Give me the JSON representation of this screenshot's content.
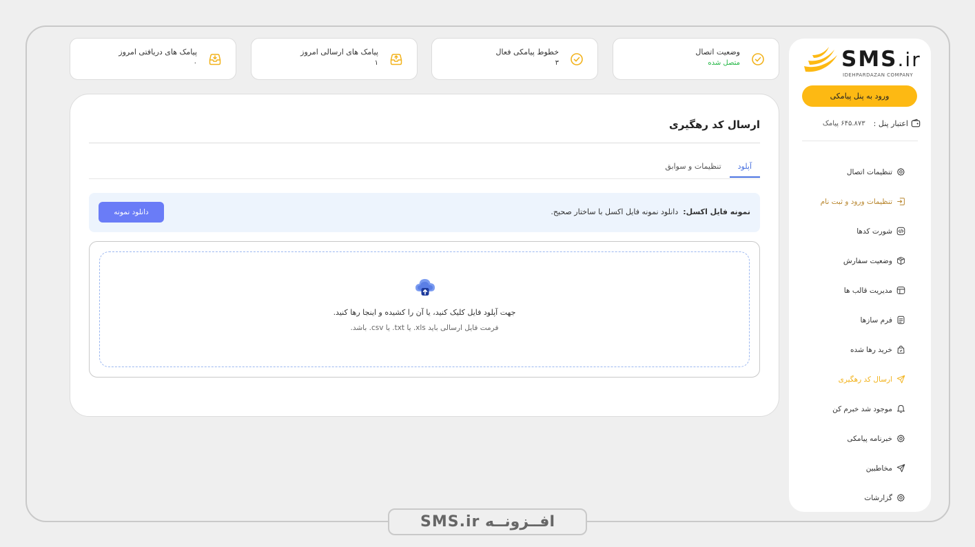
{
  "brand": {
    "name": "SMS",
    "tld": "ir",
    "subtitle": "IDEHPARDAZAN COMPANY"
  },
  "sidebar": {
    "panel_button": "ورود به پنل پیامکی",
    "credit_label": "اعتبار پنل :",
    "credit_value": "۶۴۵.۸۷۳ پیامک",
    "items": [
      {
        "label": "تنظیمات اتصال",
        "icon": "gear-icon",
        "state": "normal"
      },
      {
        "label": "تنظیمات ورود و ثبت نام",
        "icon": "login-icon",
        "state": "gold"
      },
      {
        "label": "شورت کدها",
        "icon": "code-icon",
        "state": "normal"
      },
      {
        "label": "وضعیت سفارش",
        "icon": "package-icon",
        "state": "normal"
      },
      {
        "label": "مدیریت قالب ها",
        "icon": "template-icon",
        "state": "normal"
      },
      {
        "label": "فرم سازها",
        "icon": "form-icon",
        "state": "normal"
      },
      {
        "label": "خرید رها شده",
        "icon": "bag-icon",
        "state": "normal"
      },
      {
        "label": "ارسال کد رهگیری",
        "icon": "send-icon",
        "state": "active"
      },
      {
        "label": "موجود شد خبرم کن",
        "icon": "bell-icon",
        "state": "normal"
      },
      {
        "label": "خبرنامه پیامکی",
        "icon": "gear-icon",
        "state": "normal"
      },
      {
        "label": "مخاطبین",
        "icon": "send-icon",
        "state": "normal"
      },
      {
        "label": "گزارشات",
        "icon": "gear-icon",
        "state": "normal"
      }
    ]
  },
  "stats": {
    "connection": {
      "label": "وضعیت اتصال",
      "value": "متصل شده"
    },
    "lines": {
      "label": "خطوط پیامکی فعال",
      "value": "۳"
    },
    "sent": {
      "label": "پیامک های ارسالی امروز",
      "value": "۱"
    },
    "received": {
      "label": "پیامک های دریافتی امروز",
      "value": "۰"
    }
  },
  "main": {
    "title": "ارسال کد رهگیری",
    "tabs": [
      "آپلود",
      "تنظیمات و سوابق"
    ],
    "notice_bold": "نمونه فایل اکسل:",
    "notice_text": "دانلود نمونه فایل اکسل با ساختار صحیح.",
    "download_button": "دانلود نمونه",
    "upload_line1": "جهت آپلود فایل کلیک کنید، یا آن را کشیده و اینجا رها کنید.",
    "upload_line2": "فرمت فایل ارسالی باید xls. یا txt. یا csv. باشد."
  },
  "footer_badge": "افــزونــه SMS.ir",
  "colors": {
    "accent": "#fdb913",
    "primary": "#6a7cf7",
    "success": "#1fb541",
    "link": "#4a72e0"
  }
}
